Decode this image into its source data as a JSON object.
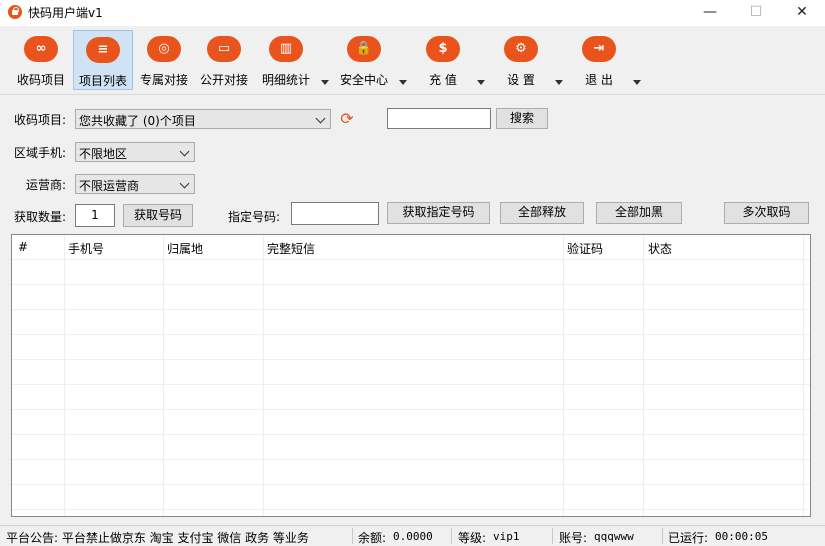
{
  "window": {
    "title": "快码用户端v1",
    "minimize": "—",
    "maximize": "☐",
    "close": "✕"
  },
  "toolbar": [
    {
      "label": "收码项目",
      "icon": "link-icon",
      "glyph": "∞"
    },
    {
      "label": "项目列表",
      "icon": "list-icon",
      "glyph": "≡"
    },
    {
      "label": "专属对接",
      "icon": "fingerprint-icon",
      "glyph": "◎"
    },
    {
      "label": "公开对接",
      "icon": "monitor-icon",
      "glyph": "▭"
    },
    {
      "label": "明细统计",
      "icon": "bar-chart-icon",
      "glyph": "▥"
    },
    {
      "label": "安全中心",
      "icon": "lock-icon",
      "glyph": "🔒"
    },
    {
      "label": "充 值",
      "icon": "dollar-icon",
      "glyph": "$"
    },
    {
      "label": "设 置",
      "icon": "gear-icon",
      "glyph": "⚙"
    },
    {
      "label": "退 出",
      "icon": "exit-icon",
      "glyph": "⇥"
    }
  ],
  "form": {
    "project_label": "收码项目:",
    "project_value": "您共收藏了 (0)个项目",
    "search_value": "",
    "search_button": "搜索",
    "region_label": "区域手机:",
    "region_value": "不限地区",
    "carrier_label": "运营商:",
    "carrier_value": "不限运营商",
    "count_label": "获取数量:",
    "count_value": "1",
    "get_number_button": "获取号码",
    "specify_label": "指定号码:",
    "specify_value": "",
    "get_specified_button": "获取指定号码",
    "release_all_button": "全部释放",
    "blacklist_all_button": "全部加黑",
    "multi_fetch_button": "多次取码"
  },
  "table": {
    "columns": [
      "#",
      "手机号",
      "归属地",
      "完整短信",
      "验证码",
      "状态"
    ],
    "rows": []
  },
  "status": {
    "notice": "平台公告: 平台禁止做京东 淘宝 支付宝 微信 政务 等业务",
    "balance_label": "余额:",
    "balance": "0.0000",
    "level_label": "等级:",
    "level": "vip1",
    "account_label": "账号:",
    "account": "qqqwww",
    "runtime_label": "已运行:",
    "runtime": "00:00:05"
  },
  "colors": {
    "accent": "#e8541c",
    "active_tab": "#cfe3f5"
  }
}
